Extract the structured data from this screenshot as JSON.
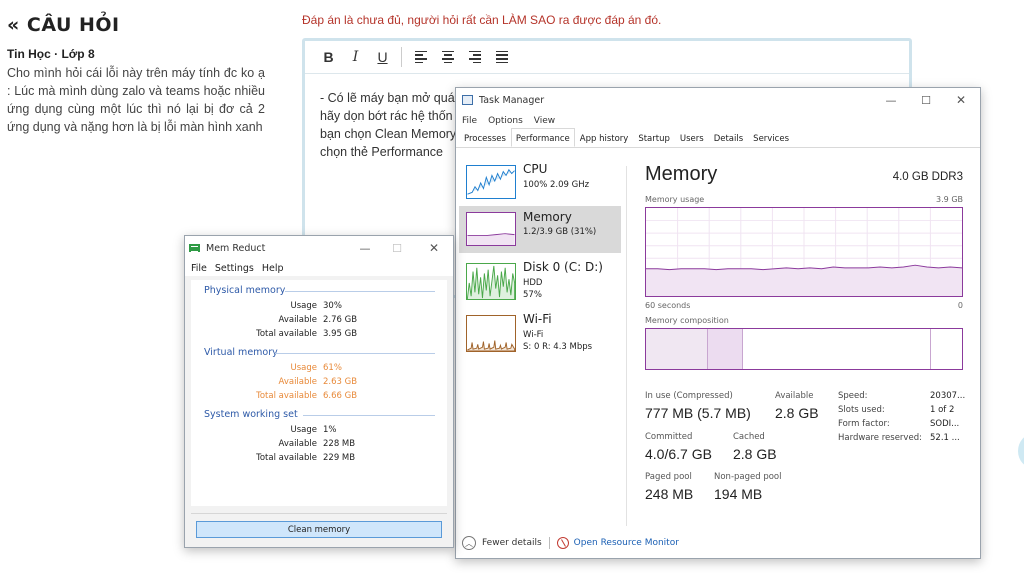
{
  "question": {
    "title": "« CÂU HỎI",
    "meta": "Tin Học · Lớp 8",
    "body": "Cho mình hỏi cái lỗi này trên máy tính đc ko ạ : Lúc mà mình dùng zalo và teams hoặc nhiều ứng dụng cùng một lúc thì nó lại bị đơ cả 2 ứng dụng và nặng hơn là bị lỗi màn hình xanh"
  },
  "answer": {
    "note": "Đáp án là chưa đủ, người hỏi rất cần LÀM SAO ra được đáp án đó.",
    "toolbar": {
      "bold": "B",
      "italic": "I",
      "underline": "U"
    },
    "text": "- Có lẽ máy bạn mở quá\nhãy dọn bớt rác hệ thốn\nbạn chọn Clean Memory\nchọn thẻ Performance"
  },
  "memreduct": {
    "title": "Mem Reduct",
    "controls": {
      "minimize": "—",
      "maximize": "☐",
      "close": "✕"
    },
    "menu": [
      "File",
      "Settings",
      "Help"
    ],
    "groups": [
      {
        "name": "Physical memory",
        "rows": [
          {
            "label": "Usage",
            "value": "30%"
          },
          {
            "label": "Available",
            "value": "2.76 GB"
          },
          {
            "label": "Total available",
            "value": "3.95 GB"
          }
        ]
      },
      {
        "name": "Virtual memory",
        "rows": [
          {
            "label": "Usage",
            "value": "61%"
          },
          {
            "label": "Available",
            "value": "2.63 GB"
          },
          {
            "label": "Total available",
            "value": "6.66 GB"
          }
        ]
      },
      {
        "name": "System working set",
        "rows": [
          {
            "label": "Usage",
            "value": "1%"
          },
          {
            "label": "Available",
            "value": "228 MB"
          },
          {
            "label": "Total available",
            "value": "229 MB"
          }
        ]
      }
    ],
    "clean_button": "Clean memory",
    "colors": {
      "group_label": "#2e5aa8",
      "warning": "#e88a3a",
      "button": "#cfe6fb"
    }
  },
  "taskmanager": {
    "title": "Task Manager",
    "controls": {
      "minimize": "—",
      "maximize": "☐",
      "close": "✕"
    },
    "menu": [
      "File",
      "Options",
      "View"
    ],
    "tabs": [
      "Processes",
      "Performance",
      "App history",
      "Startup",
      "Users",
      "Details",
      "Services"
    ],
    "active_tab": "Performance",
    "resources": [
      {
        "name": "CPU",
        "sub1": "100% 2.09 GHz",
        "color": "#1f7fcf"
      },
      {
        "name": "Memory",
        "sub1": "1.2/3.9 GB (31%)",
        "color": "#8b3a9c"
      },
      {
        "name": "Disk 0 (C: D:)",
        "sub1": "HDD",
        "sub2": "57%",
        "color": "#4aa84a"
      },
      {
        "name": "Wi-Fi",
        "sub1": "Wi-Fi",
        "sub2": "S: 0 R: 4.3 Mbps",
        "color": "#a0632a"
      }
    ],
    "memory": {
      "heading": "Memory",
      "type": "4.0 GB DDR3",
      "usage_label": "Memory usage",
      "usage_max": "3.9 GB",
      "time_left": "60 seconds",
      "time_right": "0",
      "composition_label": "Memory composition",
      "usage_series": [
        0.31,
        0.31,
        0.3,
        0.31,
        0.31,
        0.31,
        0.3,
        0.31,
        0.31,
        0.31,
        0.3,
        0.31,
        0.32,
        0.31,
        0.32,
        0.31,
        0.33,
        0.32,
        0.32,
        0.32,
        0.33,
        0.32,
        0.33,
        0.35,
        0.33,
        0.32,
        0.33,
        0.32
      ],
      "stats": {
        "in_use_label": "In use (Compressed)",
        "in_use": "777 MB (5.7 MB)",
        "available_label": "Available",
        "available": "2.8 GB",
        "committed_label": "Committed",
        "committed": "4.0/6.7 GB",
        "cached_label": "Cached",
        "cached": "2.8 GB",
        "paged_label": "Paged pool",
        "paged": "248 MB",
        "nonpaged_label": "Non-paged pool",
        "nonpaged": "194 MB"
      },
      "details": [
        {
          "label": "Speed:",
          "value": "20307..."
        },
        {
          "label": "Slots used:",
          "value": "1 of 2"
        },
        {
          "label": "Form factor:",
          "value": "SODI..."
        },
        {
          "label": "Hardware reserved:",
          "value": "52.1 ..."
        }
      ]
    },
    "footer": {
      "fewer": "Fewer details",
      "monitor": "Open Resource Monitor"
    }
  }
}
